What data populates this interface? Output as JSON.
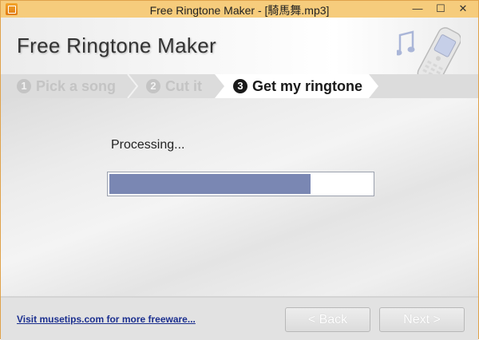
{
  "window": {
    "title": "Free Ringtone Maker - [騎馬舞.mp3]",
    "controls": {
      "minimize": "—",
      "maximize": "☐",
      "close": "✕"
    }
  },
  "header": {
    "app_title": "Free Ringtone Maker"
  },
  "steps": [
    {
      "number": "1",
      "label": "Pick a song",
      "state": "inactive"
    },
    {
      "number": "2",
      "label": "Cut it",
      "state": "inactive"
    },
    {
      "number": "3",
      "label": "Get my ringtone",
      "state": "active"
    }
  ],
  "content": {
    "status_text": "Processing...",
    "progress_fraction": 0.765,
    "progress_color": "#7a87b3"
  },
  "footer": {
    "link_text": "Visit musetips.com for more freeware...",
    "back_label": "< Back",
    "next_label": "Next >"
  },
  "icons": [
    "app-icon",
    "music-note-icon",
    "mobile-phone-icon",
    "minimize-icon",
    "maximize-icon",
    "close-icon"
  ]
}
